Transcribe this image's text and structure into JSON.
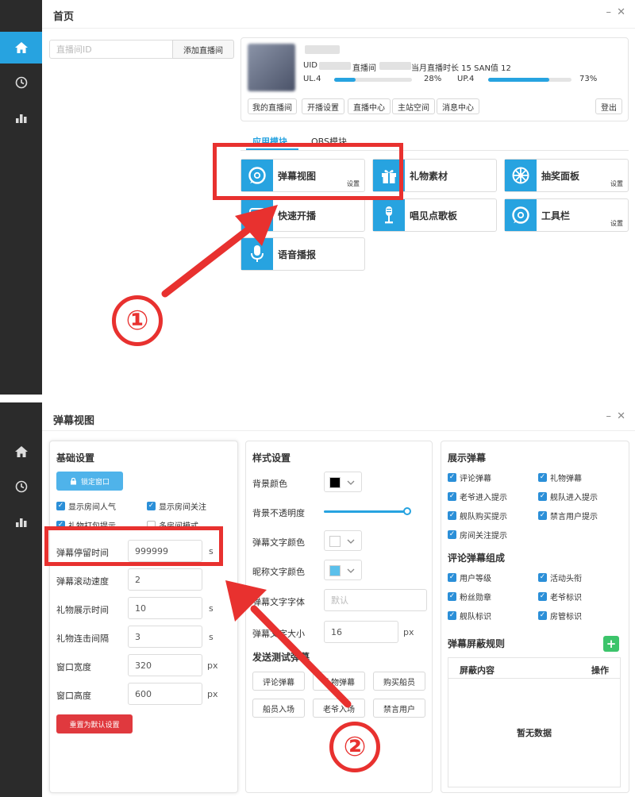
{
  "top": {
    "title": "首页",
    "input_placeholder": "直播间ID",
    "add_button": "添加直播间",
    "profile": {
      "uid_label": "UID",
      "room_label": "直播间",
      "month_text": "当月直播时长 15 SAN值 12",
      "ul_label": "UL.4",
      "ul_percent": 28,
      "ul_percent_text": "28%",
      "up_label": "UP.4",
      "up_percent": 73,
      "up_percent_text": "73%"
    },
    "buttons": [
      "我的直播间",
      "开播设置",
      "直播中心",
      "主站空间",
      "消息中心"
    ],
    "logout": "登出",
    "tabs": [
      "应用模块",
      "OBS模块"
    ],
    "tiles": [
      {
        "name": "弹幕视图",
        "sub": "设置",
        "icon": "danmaku-icon"
      },
      {
        "name": "礼物素材",
        "sub": "",
        "icon": "gift-icon"
      },
      {
        "name": "抽奖面板",
        "sub": "设置",
        "icon": "lottery-wheel-icon"
      },
      {
        "name": "快速开播",
        "sub": "",
        "icon": "play-icon"
      },
      {
        "name": "唱见点歌板",
        "sub": "",
        "icon": "microphone-stand-icon"
      },
      {
        "name": "工具栏",
        "sub": "设置",
        "icon": "toolbar-icon"
      },
      {
        "name": "语音播报",
        "sub": "",
        "icon": "microphone-icon"
      }
    ],
    "annotation": "①"
  },
  "bottom": {
    "title": "弹幕视图",
    "basic": {
      "title": "基础设置",
      "lock_button": "锁定窗口",
      "checks": [
        {
          "label": "显示房间人气",
          "checked": true
        },
        {
          "label": "显示房间关注",
          "checked": true
        },
        {
          "label": "礼物打包提示",
          "checked": true
        },
        {
          "label": "多房间模式",
          "checked": false
        }
      ],
      "fields": [
        {
          "label": "弹幕停留时间",
          "value": "999999",
          "unit": "s"
        },
        {
          "label": "弹幕滚动速度",
          "value": "2",
          "unit": ""
        },
        {
          "label": "礼物展示时间",
          "value": "10",
          "unit": "s"
        },
        {
          "label": "礼物连击间隔",
          "value": "3",
          "unit": "s"
        },
        {
          "label": "窗口宽度",
          "value": "320",
          "unit": "px"
        },
        {
          "label": "窗口高度",
          "value": "600",
          "unit": "px"
        }
      ],
      "reset_button": "重置为默认设置"
    },
    "style": {
      "title": "样式设置",
      "bg_color_label": "背景颜色",
      "bg_color": "#000000",
      "opacity_label": "背景不透明度",
      "opacity_value": 0.98,
      "text_color_label": "弹幕文字颜色",
      "text_color": "#ffffff",
      "nick_color_label": "昵称文字颜色",
      "nick_color": "#5bc0eb",
      "font_label": "弹幕文字字体",
      "font_placeholder": "默认",
      "size_label": "弹幕文字大小",
      "size_value": "16",
      "size_unit": "px",
      "test_title": "发送测试弹幕",
      "test_buttons": [
        "评论弹幕",
        "礼物弹幕",
        "购买船员",
        "船员入场",
        "老爷入场",
        "禁言用户"
      ]
    },
    "display": {
      "title": "展示弹幕",
      "checks": [
        "评论弹幕",
        "礼物弹幕",
        "老爷进入提示",
        "舰队进入提示",
        "舰队购买提示",
        "禁言用户提示",
        "房间关注提示"
      ],
      "compose_title": "评论弹幕组成",
      "compose_checks": [
        "用户等级",
        "活动头衔",
        "粉丝勋章",
        "老爷标识",
        "舰队标识",
        "房管标识"
      ],
      "block_title": "弹幕屏蔽规则",
      "add_symbol": "+",
      "table_headers": [
        "屏蔽内容",
        "操作"
      ],
      "empty_text": "暂无数据"
    },
    "annotation": "②"
  },
  "colors": {
    "accent": "#27a3e0",
    "sidebar": "#2b2b2b",
    "annotation": "#e8312f",
    "danger": "#e0393e",
    "success": "#3cc46b"
  }
}
